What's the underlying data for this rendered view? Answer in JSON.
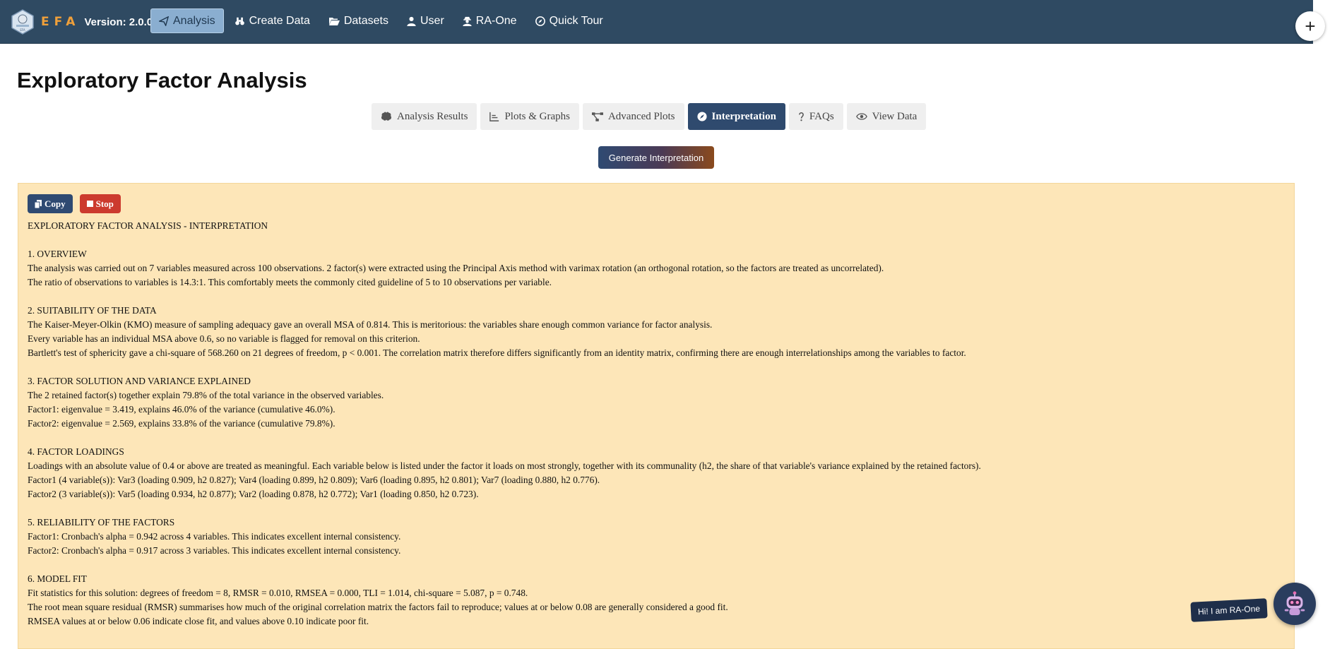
{
  "app": {
    "brand_text": "EFA",
    "version": "Version: 2.0.0",
    "logo_text": [
      "EFA"
    ]
  },
  "nav": {
    "items": [
      {
        "label": "Analysis",
        "icon": "paper-plane-icon",
        "active": true
      },
      {
        "label": "Create Data",
        "icon": "binoculars-icon",
        "active": false
      },
      {
        "label": "Datasets",
        "icon": "folder-open-icon",
        "active": false
      },
      {
        "label": "User",
        "icon": "user-icon",
        "active": false
      },
      {
        "label": "RA-One",
        "icon": "user-secret-icon",
        "active": false
      },
      {
        "label": "Quick Tour",
        "icon": "compass-icon",
        "active": false
      }
    ],
    "plus_symbol": "+"
  },
  "page": {
    "title": "Exploratory Factor Analysis"
  },
  "tabs": [
    {
      "label": "Analysis Results",
      "icon": "brain-icon",
      "active": false
    },
    {
      "label": "Plots & Graphs",
      "icon": "chart-line-icon",
      "active": false
    },
    {
      "label": "Advanced Plots",
      "icon": "project-diagram-icon",
      "active": false
    },
    {
      "label": "Interpretation",
      "icon": "compass-icon",
      "active": true
    },
    {
      "label": "FAQs",
      "icon": "question-icon",
      "active": false
    },
    {
      "label": "View Data",
      "icon": "eye-icon",
      "active": false
    }
  ],
  "generate_button": "Generate Interpretation",
  "panel": {
    "copy_label": "Copy",
    "stop_label": "Stop",
    "lines": [
      "EXPLORATORY FACTOR ANALYSIS - INTERPRETATION",
      "",
      "1. OVERVIEW",
      "The analysis was carried out on 7 variables measured across 100 observations. 2 factor(s) were extracted using the Principal Axis method with varimax rotation (an orthogonal rotation, so the factors are treated as uncorrelated).",
      "The ratio of observations to variables is 14.3:1. This comfortably meets the commonly cited guideline of 5 to 10 observations per variable.",
      "",
      "2. SUITABILITY OF THE DATA",
      "The Kaiser-Meyer-Olkin (KMO) measure of sampling adequacy gave an overall MSA of 0.814. This is meritorious: the variables share enough common variance for factor analysis.",
      "Every variable has an individual MSA above 0.6, so no variable is flagged for removal on this criterion.",
      "Bartlett's test of sphericity gave a chi-square of 568.260 on 21 degrees of freedom, p < 0.001. The correlation matrix therefore differs significantly from an identity matrix, confirming there are enough interrelationships among the variables to factor.",
      "",
      "3. FACTOR SOLUTION AND VARIANCE EXPLAINED",
      "The 2 retained factor(s) together explain 79.8% of the total variance in the observed variables.",
      "Factor1: eigenvalue = 3.419, explains 46.0% of the variance (cumulative 46.0%).",
      "Factor2: eigenvalue = 2.569, explains 33.8% of the variance (cumulative 79.8%).",
      "",
      "4. FACTOR LOADINGS",
      "Loadings with an absolute value of 0.4 or above are treated as meaningful. Each variable below is listed under the factor it loads on most strongly, together with its communality (h2, the share of that variable's variance explained by the retained factors).",
      "Factor1 (4 variable(s)): Var3 (loading 0.909, h2 0.827); Var4 (loading 0.899, h2 0.809); Var6 (loading 0.895, h2 0.801); Var7 (loading 0.880, h2 0.776).",
      "Factor2 (3 variable(s)): Var5 (loading 0.934, h2 0.877); Var2 (loading 0.878, h2 0.772); Var1 (loading 0.850, h2 0.723).",
      "",
      "5. RELIABILITY OF THE FACTORS",
      "Factor1: Cronbach's alpha = 0.942 across 4 variables. This indicates excellent internal consistency.",
      "Factor2: Cronbach's alpha = 0.917 across 3 variables. This indicates excellent internal consistency.",
      "",
      "6. MODEL FIT",
      "Fit statistics for this solution: degrees of freedom = 8, RMSR = 0.010, RMSEA = 0.000, TLI = 1.014, chi-square = 5.087, p = 0.748.",
      "The root mean square residual (RMSR) summarises how much of the original correlation matrix the factors fail to reproduce; values at or below 0.08 are generally considered a good fit.",
      "RMSEA values at or below 0.06 indicate close fit, and values above 0.10 indicate poor fit."
    ]
  },
  "chat": {
    "bubble_text": "Hi! I am RA-One",
    "avatar_icon": "robot-icon"
  },
  "colors": {
    "navbar": "#2f4a62",
    "brand_orange": "#f0a03a",
    "active_nav": "#8aaed0",
    "active_tab": "#2f4a6e",
    "panel_bg": "#fde6b8",
    "copy_btn": "#2f4a72",
    "stop_btn": "#cc3a2e"
  }
}
